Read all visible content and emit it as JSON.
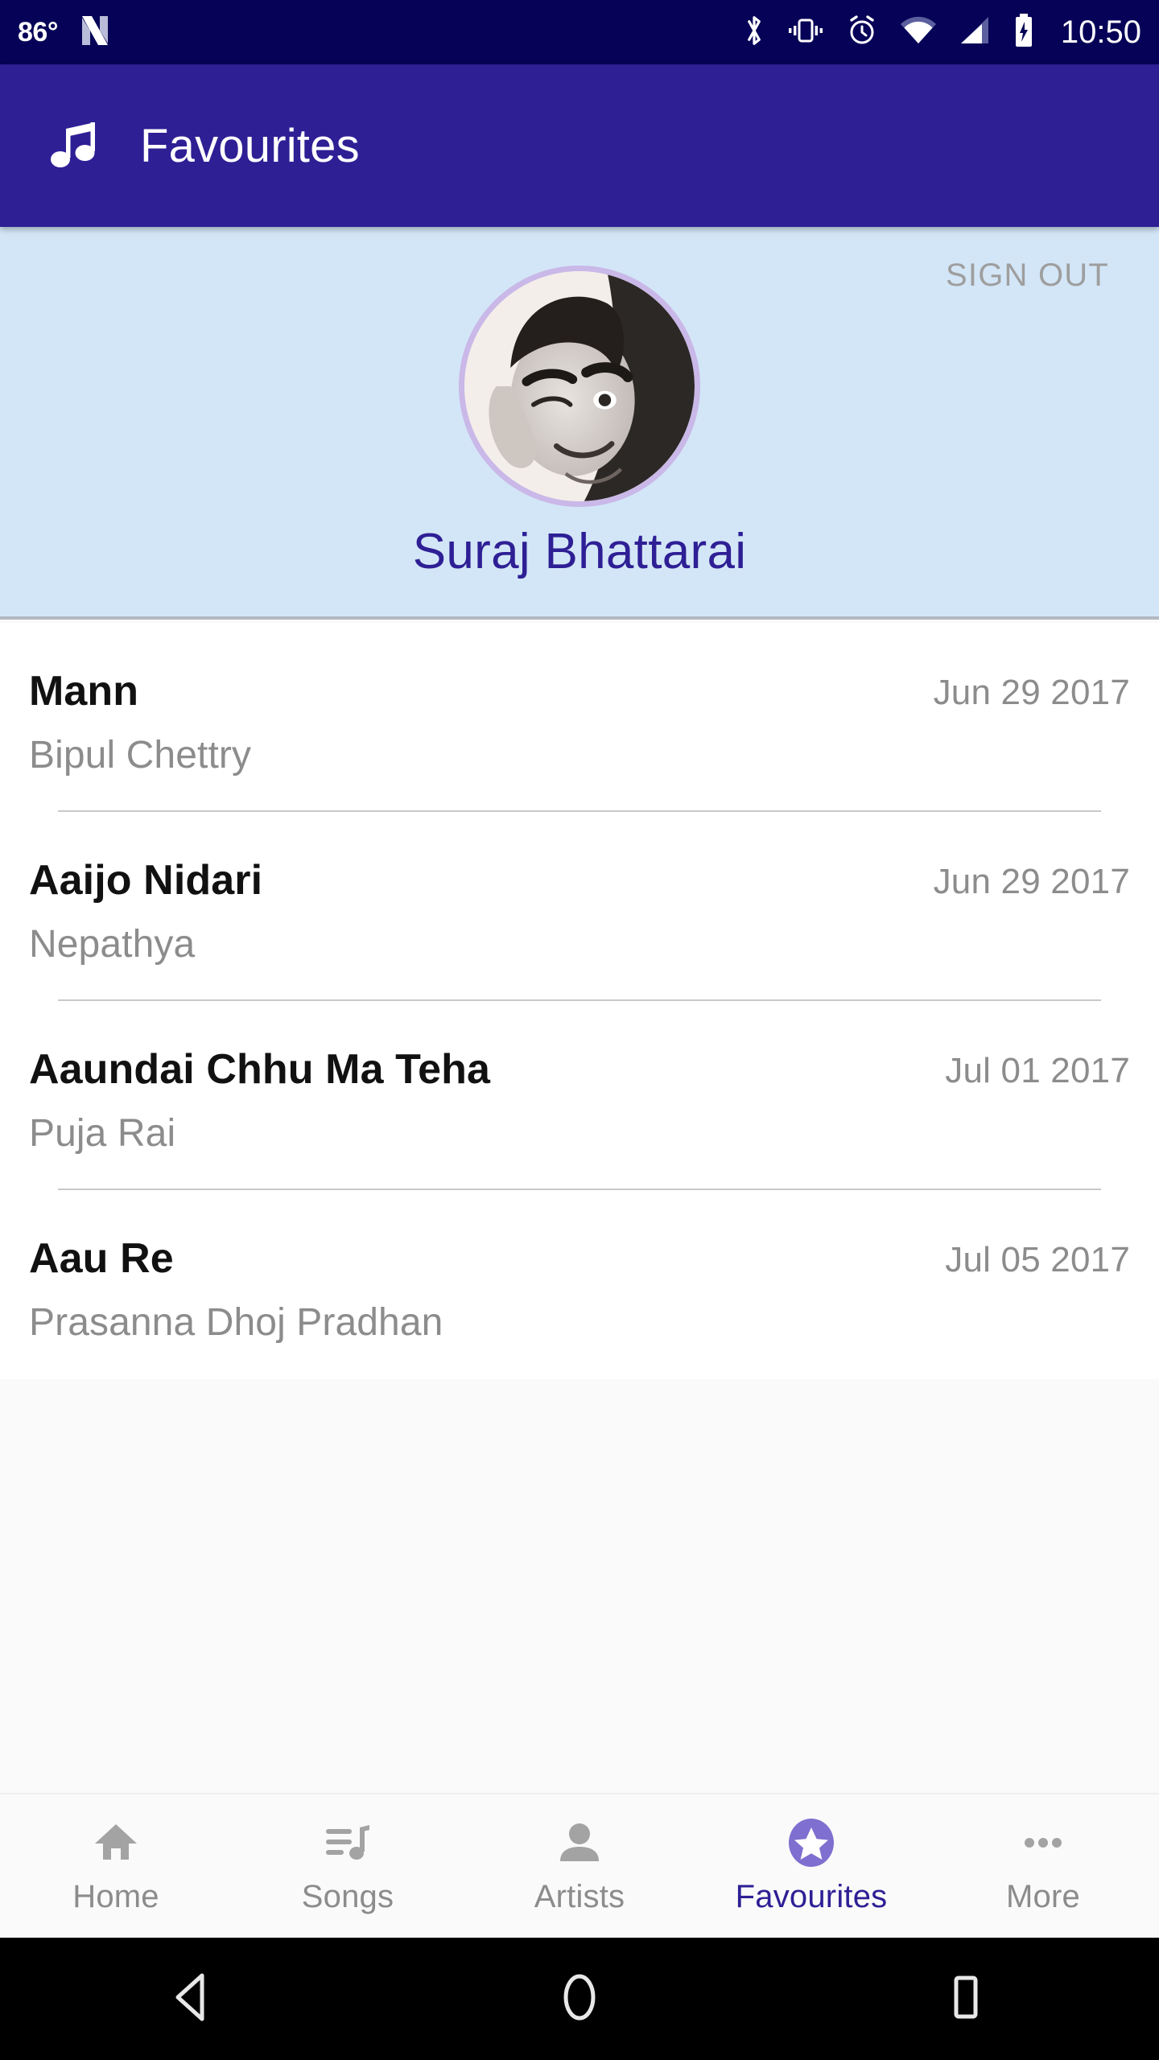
{
  "status_bar": {
    "temperature": "86°",
    "os_logo_icon": "android-nougat-n-logo",
    "icons": [
      "bluetooth-icon",
      "vibrate-icon",
      "alarm-icon",
      "wifi-icon",
      "cellular-signal-icon",
      "battery-charging-icon"
    ],
    "time": "10:50",
    "background_color": "#060257"
  },
  "app_bar": {
    "icon": "music-note-icon",
    "title": "Favourites",
    "background_color": "#2e1f95",
    "text_color": "#ffffff"
  },
  "profile": {
    "sign_out_label": "SIGN OUT",
    "avatar_icon": "user-avatar-photo",
    "name": "Suraj Bhattarai",
    "background_color": "#d3e6f7",
    "name_color": "#2e1f95",
    "avatar_border_color": "#c9b8e8"
  },
  "songs": [
    {
      "title": "Mann",
      "artist": "Bipul Chettry",
      "date": "Jun 29 2017"
    },
    {
      "title": "Aaijo Nidari",
      "artist": "Nepathya",
      "date": "Jun 29 2017"
    },
    {
      "title": "Aaundai Chhu Ma Teha",
      "artist": "Puja Rai",
      "date": "Jul 01 2017"
    },
    {
      "title": "Aau Re",
      "artist": "Prasanna Dhoj Pradhan",
      "date": "Jul 05 2017"
    }
  ],
  "tab_bar": {
    "active_color": "#2e1f95",
    "inactive_color": "#8c8c8c",
    "active_badge_color": "#7e6fd0",
    "tabs": [
      {
        "label": "Home",
        "icon": "home-icon",
        "active": false
      },
      {
        "label": "Songs",
        "icon": "queue-music-icon",
        "active": false
      },
      {
        "label": "Artists",
        "icon": "person-icon",
        "active": false
      },
      {
        "label": "Favourites",
        "icon": "star-icon",
        "active": true
      },
      {
        "label": "More",
        "icon": "more-horizontal-icon",
        "active": false
      }
    ]
  },
  "system_nav": {
    "back_icon": "back-triangle-icon",
    "home_icon": "home-circle-icon",
    "recents_icon": "recents-square-icon"
  }
}
